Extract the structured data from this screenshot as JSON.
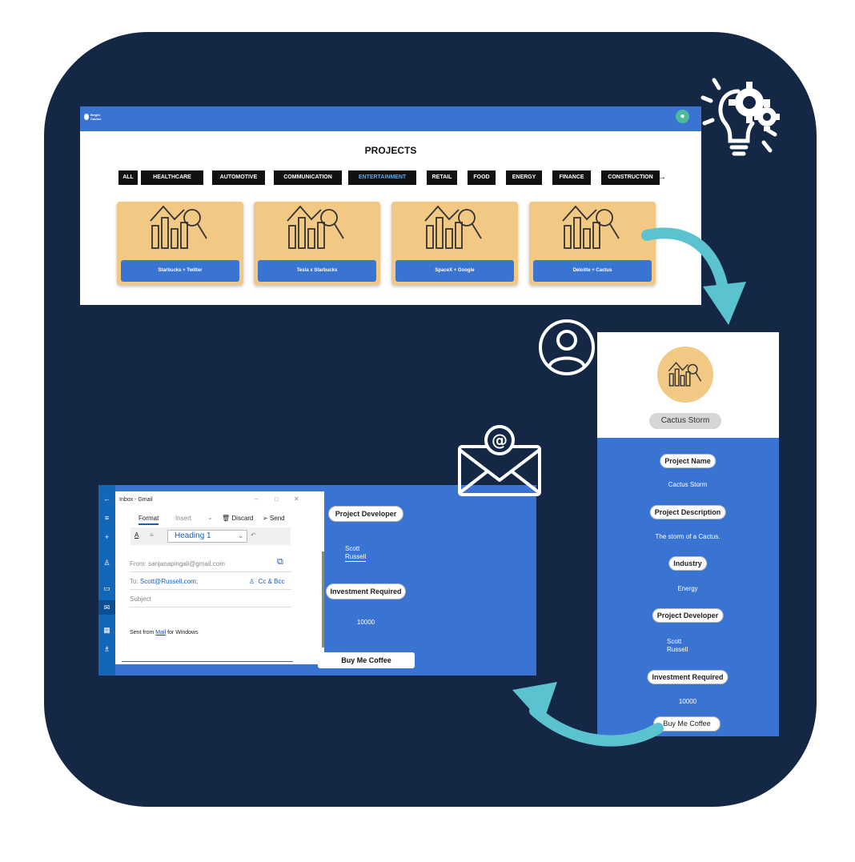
{
  "projects_screen": {
    "logo": "Bright\nCactus",
    "avatar_icon": "user-icon",
    "title": "PROJECTS",
    "categories": [
      "ALL",
      "HEALTHCARE",
      "AUTOMOTIVE",
      "COMMUNICATION",
      "ENTERTAINMENT",
      "RETAIL",
      "FOOD",
      "ENERGY",
      "FINANCE",
      "CONSTRUCTION"
    ],
    "active_category": "ENTERTAINMENT",
    "scroll_arrow": "→",
    "cards": [
      {
        "label": "Starbucks + Twitter"
      },
      {
        "label": "Tesla x Starbucks"
      },
      {
        "label": "SpaceX + Google"
      },
      {
        "label": "Deloitte + Cactus"
      }
    ]
  },
  "detail_screen": {
    "project_title": "Cactus Storm",
    "project_name_label": "Project Name",
    "project_name": "Cactus Storm",
    "description_label": "Project Description",
    "description": "The storm of a Cactus.",
    "industry_label": "Industry",
    "industry": "Energy",
    "developer_label": "Project Developer",
    "developer_first": "Scott",
    "developer_last": "Russell",
    "investment_label": "Investment Required",
    "investment": "10000",
    "coffee_button": "Buy Me Coffee"
  },
  "email_screen": {
    "window_title": "Inbox - Gmail",
    "tab_format": "Format",
    "tab_insert": "Insert",
    "discard": "Discard",
    "send": "Send",
    "style": "Heading 1",
    "from_label": "From:",
    "from_value": "sanjanapingali@gmail.com",
    "to_label": "To:",
    "to_value": "Scott@Russell.com;",
    "cc_bcc": "Cc & Bcc",
    "subject": "Subject",
    "signature_prefix": "Sent from ",
    "signature_link": "Mail",
    "signature_suffix": " for Windows",
    "developer_label": "Project Developer",
    "developer_first": "Scott",
    "developer_last": "Russell",
    "investment_label": "Investment Required",
    "investment": "10000",
    "coffee_button": "Buy Me Coffee"
  },
  "icons": [
    "lightbulb-gears-icon",
    "user-circle-icon",
    "envelope-at-icon",
    "curved-arrow-icon",
    "chart-magnifier-icon"
  ],
  "colors": {
    "navy": "#142845",
    "blue": "#3a74d2",
    "card": "#f2c885",
    "teal": "#5bc2cf"
  }
}
